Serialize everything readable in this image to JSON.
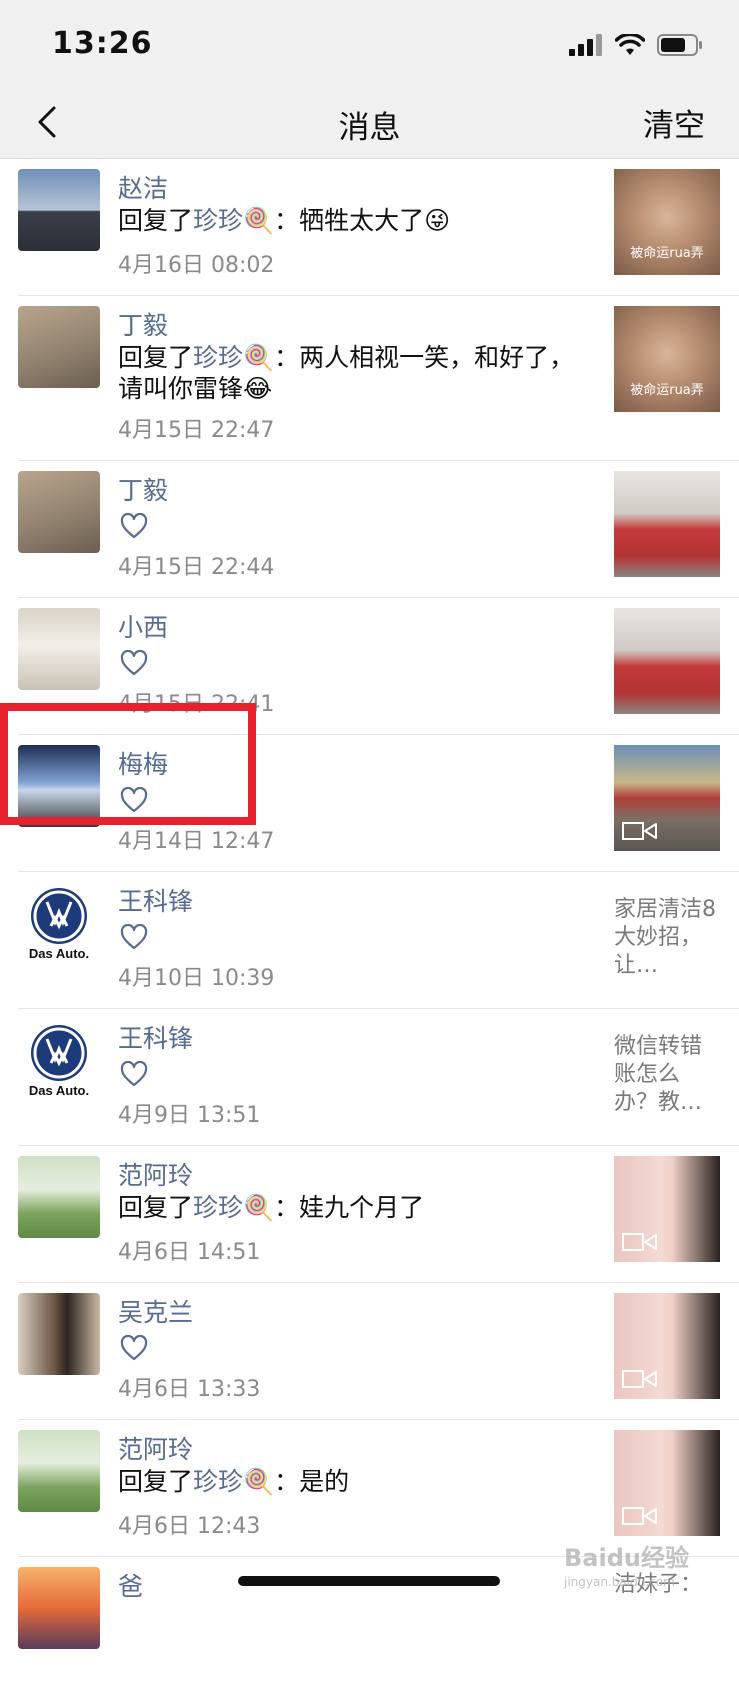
{
  "status_bar": {
    "time": "13:26"
  },
  "nav": {
    "title": "消息",
    "clear_label": "清空"
  },
  "messages": [
    {
      "name": "赵洁",
      "content_prefix": "回复了",
      "mention": "珍珍🍭",
      "content": "：牺牲太大了😜",
      "time": "4月16日 08:02",
      "thumb_caption": "被命运rua弄"
    },
    {
      "name": "丁毅",
      "content_prefix": "回复了",
      "mention": "珍珍🍭",
      "content": "：两人相视一笑，和好了，请叫你雷锋😂",
      "time": "4月15日 22:47",
      "thumb_caption": "被命运rua弄"
    },
    {
      "name": "丁毅",
      "time": "4月15日 22:44"
    },
    {
      "name": "小西",
      "time": "4月15日 22:41"
    },
    {
      "name": "梅梅",
      "time": "4月14日 12:47"
    },
    {
      "name": "王科锋",
      "time": "4月10日 10:39",
      "thumb_text": "家居清洁8大妙招，让…",
      "avatar_text": "Das Auto."
    },
    {
      "name": "王科锋",
      "time": "4月9日 13:51",
      "thumb_text": "微信转错账怎么办？教…",
      "avatar_text": "Das Auto."
    },
    {
      "name": "范阿玲",
      "content_prefix": "回复了",
      "mention": "珍珍🍭",
      "content": "：娃九个月了",
      "time": "4月6日 14:51"
    },
    {
      "name": "吴克兰",
      "time": "4月6日 13:33"
    },
    {
      "name": "范阿玲",
      "content_prefix": "回复了",
      "mention": "珍珍🍭",
      "content": "：是的",
      "time": "4月6日 12:43"
    },
    {
      "name": "爸",
      "thumb_text": "洁妹子："
    }
  ],
  "watermark": {
    "brand": "Baidu经验",
    "url": "jingyan.baidu.com"
  }
}
